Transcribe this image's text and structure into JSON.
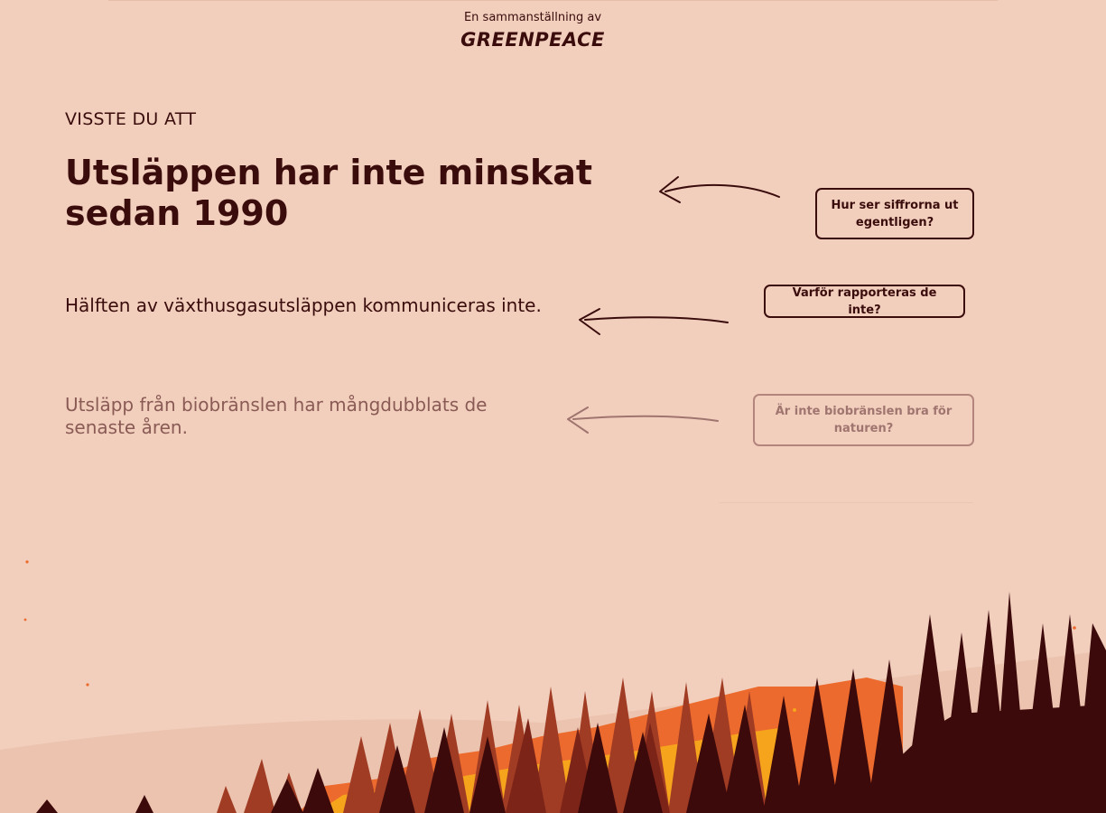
{
  "header": {
    "presenter_text": "En sammanställning av",
    "logo_text": "GREENPEACE"
  },
  "main": {
    "kicker": "VISSTE DU ATT",
    "headline": "Utsläppen har inte minskat sedan 1990",
    "fact_2": "Hälften av växthusgasutsläppen kommuniceras inte.",
    "fact_3": "Utsläpp från biobränslen har mångdubblats de senaste åren."
  },
  "buttons": {
    "numbers": "Hur ser siffrorna ut egentligen?",
    "why_not_reported": "Varför rapporteras de inte?",
    "biofuels": "Är inte biobränslen bra för naturen?"
  },
  "colors": {
    "background": "#f2cfbd",
    "text_dark": "#3a0c0c",
    "text_faded": "#8a5a55",
    "fire_orange": "#ec6a2d",
    "fire_yellow": "#f6a41c",
    "tree_dark": "#3d0a0b",
    "tree_red": "#a03b24"
  },
  "icons": {
    "arrow": "hand-drawn-arrow-left-icon",
    "illustration": "burning-forest-illustration"
  }
}
